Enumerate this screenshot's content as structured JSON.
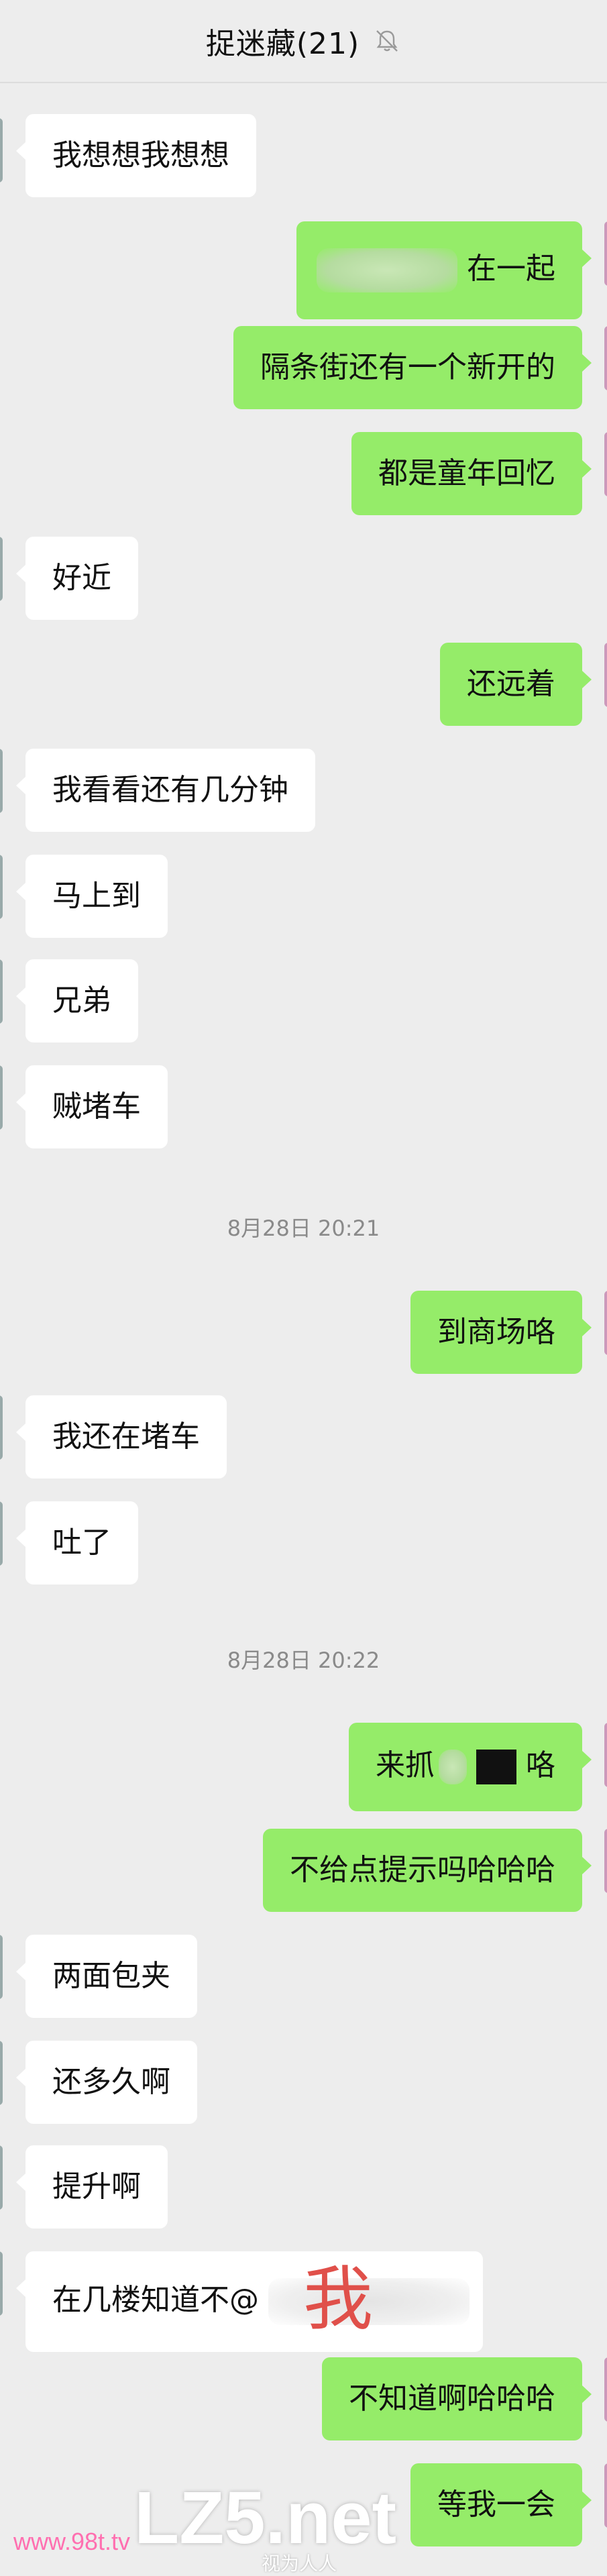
{
  "header": {
    "title": "捉迷藏(21)",
    "mute_icon": "bell-muted-icon"
  },
  "messages": [
    {
      "side": "in",
      "text": "我想想我想想"
    },
    {
      "side": "out",
      "text": "在一起",
      "redacted": true
    },
    {
      "side": "out",
      "text": "隔条街还有一个新开的"
    },
    {
      "side": "out",
      "text": "都是童年回忆"
    },
    {
      "side": "in",
      "text": "好近"
    },
    {
      "side": "out",
      "text": "还远着"
    },
    {
      "side": "in",
      "text": "我看看还有几分钟"
    },
    {
      "side": "in",
      "text": "马上到"
    },
    {
      "side": "in",
      "text": "兄弟"
    },
    {
      "side": "in",
      "text": "贼堵车"
    },
    {
      "side": "ts",
      "text": "8月28日 20:21"
    },
    {
      "side": "out",
      "text": "到商场咯"
    },
    {
      "side": "in",
      "text": "我还在堵车"
    },
    {
      "side": "in",
      "text": "吐了"
    },
    {
      "side": "ts",
      "text": "8月28日 20:22"
    },
    {
      "side": "out",
      "text_a": "来抓",
      "text_b": "咯",
      "redacted": true
    },
    {
      "side": "out",
      "text": "不给点提示吗哈哈哈"
    },
    {
      "side": "in",
      "text": "两面包夹"
    },
    {
      "side": "in",
      "text": "还多久啊"
    },
    {
      "side": "in",
      "text": "提升啊"
    },
    {
      "side": "in",
      "text": "在几楼知道不@",
      "mention_overlay": "我"
    },
    {
      "side": "out",
      "text": "不知道啊哈哈哈"
    },
    {
      "side": "out",
      "text": "等我一会"
    }
  ],
  "watermark": {
    "main": "LZ5.net",
    "site": "www.98t.tv",
    "sub": "视为人人"
  },
  "colors": {
    "background": "#ededed",
    "incoming": "#ffffff",
    "outgoing": "#95ec69"
  }
}
